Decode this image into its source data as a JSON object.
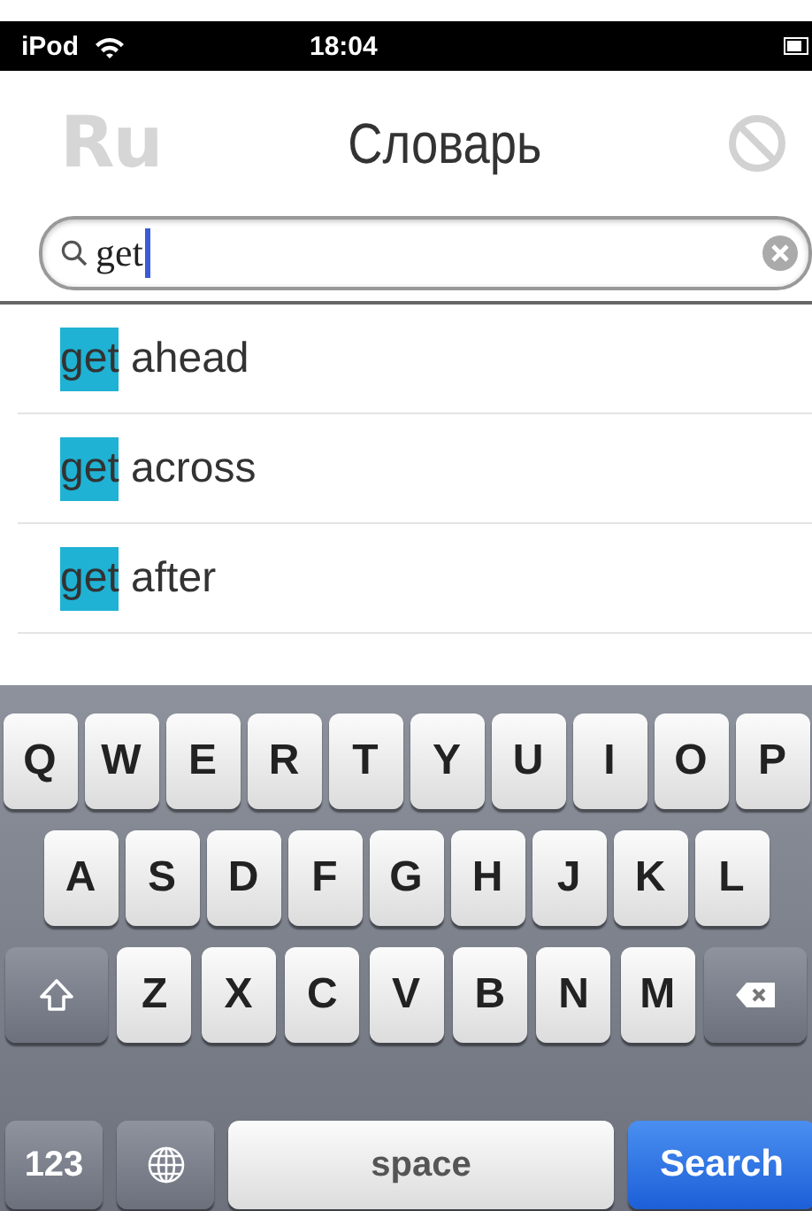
{
  "status_bar": {
    "carrier": "iPod",
    "time": "18:04"
  },
  "nav": {
    "left": "Ru",
    "title": "Словарь"
  },
  "search": {
    "value": "get"
  },
  "results": [
    {
      "match": "get",
      "rest": "ahead"
    },
    {
      "match": "get",
      "rest": "across"
    },
    {
      "match": "get",
      "rest": "after"
    }
  ],
  "keyboard": {
    "rows": [
      {
        "keys": [
          {
            "kind": "letter",
            "label": "Q"
          },
          {
            "kind": "letter",
            "label": "W"
          },
          {
            "kind": "letter",
            "label": "E"
          },
          {
            "kind": "letter",
            "label": "R"
          },
          {
            "kind": "letter",
            "label": "T"
          },
          {
            "kind": "letter",
            "label": "Y"
          },
          {
            "kind": "letter",
            "label": "U"
          },
          {
            "kind": "letter",
            "label": "I"
          },
          {
            "kind": "letter",
            "label": "O"
          },
          {
            "kind": "letter",
            "label": "P"
          }
        ]
      },
      {
        "keys": [
          {
            "kind": "letter",
            "label": "A"
          },
          {
            "kind": "letter",
            "label": "S"
          },
          {
            "kind": "letter",
            "label": "D"
          },
          {
            "kind": "letter",
            "label": "F"
          },
          {
            "kind": "letter",
            "label": "G"
          },
          {
            "kind": "letter",
            "label": "H"
          },
          {
            "kind": "letter",
            "label": "J"
          },
          {
            "kind": "letter",
            "label": "K"
          },
          {
            "kind": "letter",
            "label": "L"
          }
        ]
      },
      {
        "keys": [
          {
            "kind": "shift"
          },
          {
            "kind": "letter",
            "label": "Z"
          },
          {
            "kind": "letter",
            "label": "X"
          },
          {
            "kind": "letter",
            "label": "C"
          },
          {
            "kind": "letter",
            "label": "V"
          },
          {
            "kind": "letter",
            "label": "B"
          },
          {
            "kind": "letter",
            "label": "N"
          },
          {
            "kind": "letter",
            "label": "M"
          },
          {
            "kind": "delete"
          }
        ]
      },
      {
        "keys": [
          {
            "kind": "mode",
            "label": "123"
          },
          {
            "kind": "globe"
          },
          {
            "kind": "space",
            "label": "space"
          },
          {
            "kind": "action",
            "label": "Search"
          }
        ]
      }
    ]
  }
}
